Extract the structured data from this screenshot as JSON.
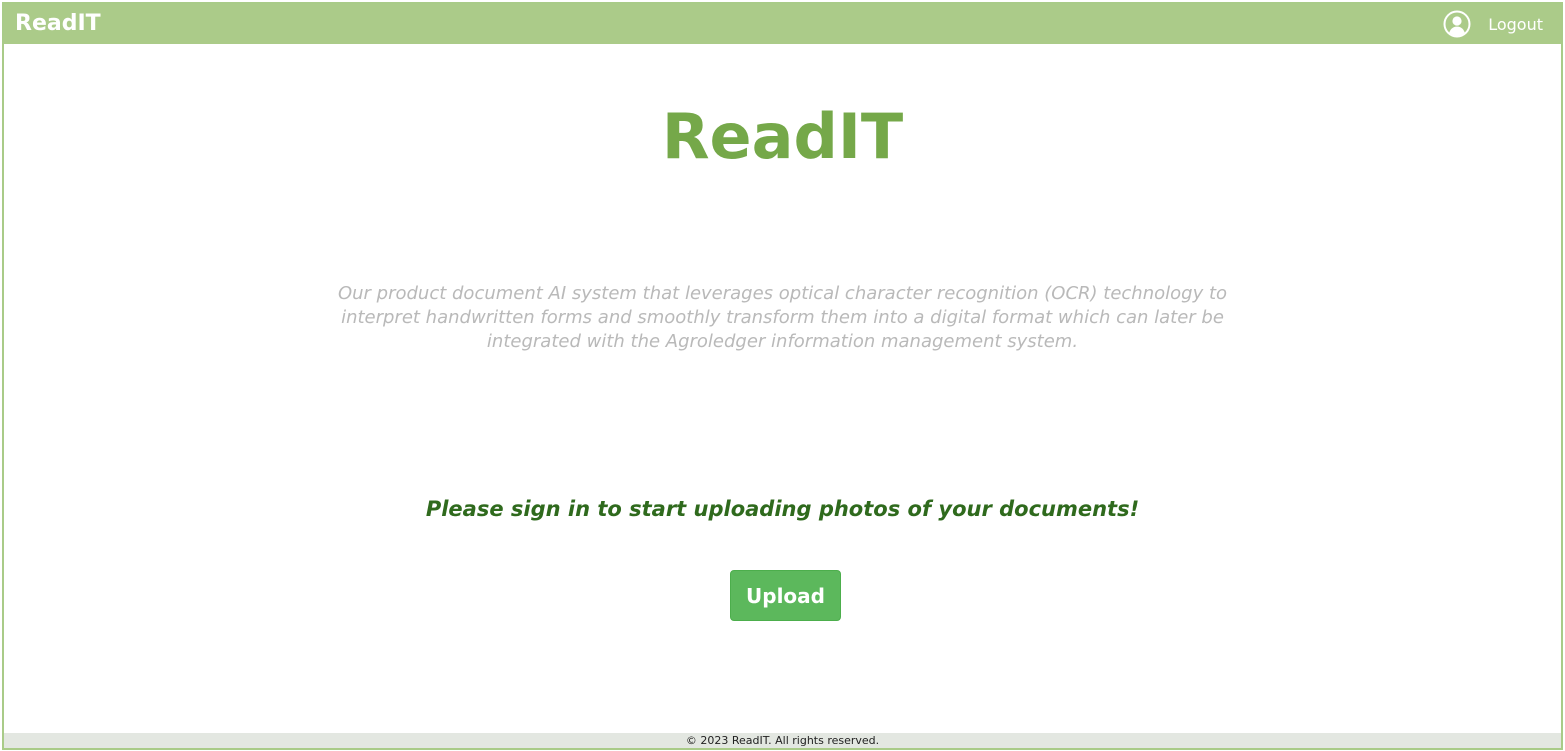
{
  "navbar": {
    "brand": "ReadIT",
    "logout_label": "Logout",
    "user_icon": "user-circle-icon"
  },
  "hero": {
    "title": "ReadIT",
    "description": "Our product document AI system that leverages optical character recognition (OCR) technology to interpret handwritten forms and smoothly transform them into a digital format which can later be integrated with the Agroledger information management system.",
    "signin_prompt": "Please sign in to start uploading photos of your documents!",
    "upload_label": "Upload"
  },
  "footer": {
    "copyright": "© 2023 ReadIT. All rights reserved."
  },
  "colors": {
    "navbar_bg": "#abcb89",
    "title_green": "#75a849",
    "prompt_green": "#2f6a1d",
    "button_green": "#5cb85c",
    "description_gray": "#b9b9b9",
    "footer_bg": "#e3e7e1"
  }
}
